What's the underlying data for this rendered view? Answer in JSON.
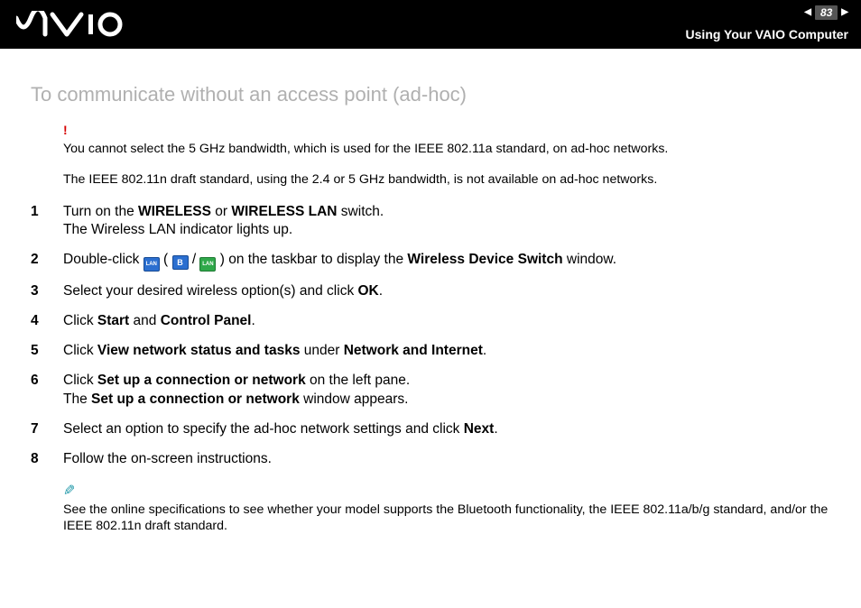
{
  "header": {
    "page_number": "83",
    "section_title": "Using Your VAIO Computer"
  },
  "heading": "To communicate without an access point (ad-hoc)",
  "warning": {
    "line1": "You cannot select the 5 GHz bandwidth, which is used for the IEEE 802.11a standard, on ad-hoc networks.",
    "line2": "The IEEE 802.11n draft standard, using the 2.4 or 5 GHz bandwidth, is not available on ad-hoc networks."
  },
  "steps": {
    "s1a": "Turn on the ",
    "s1b": "WIRELESS",
    "s1c": " or ",
    "s1d": "WIRELESS LAN",
    "s1e": " switch.",
    "s1sub": "The Wireless LAN indicator lights up.",
    "s2a": "Double-click ",
    "s2b": " ( ",
    "s2c": " / ",
    "s2d": " ) on the taskbar to display the ",
    "s2e": "Wireless Device Switch",
    "s2f": " window.",
    "s3a": "Select your desired wireless option(s) and click ",
    "s3b": "OK",
    "s3c": ".",
    "s4a": "Click ",
    "s4b": "Start",
    "s4c": " and ",
    "s4d": "Control Panel",
    "s4e": ".",
    "s5a": "Click ",
    "s5b": "View network status and tasks",
    "s5c": " under ",
    "s5d": "Network and Internet",
    "s5e": ".",
    "s6a": "Click ",
    "s6b": "Set up a connection or network",
    "s6c": " on the left pane.",
    "s6suba": "The ",
    "s6subb": "Set up a connection or network",
    "s6subc": " window appears.",
    "s7a": "Select an option to specify the ad-hoc network settings and click ",
    "s7b": "Next",
    "s7c": ".",
    "s8": "Follow the on-screen instructions."
  },
  "footnote": "See the online specifications to see whether your model supports the Bluetooth functionality, the IEEE 802.11a/b/g standard, and/or the IEEE 802.11n draft standard.",
  "icons": {
    "bt_label": "B",
    "lan_label": "LAN"
  }
}
